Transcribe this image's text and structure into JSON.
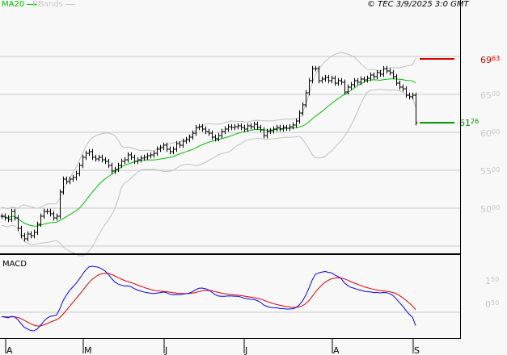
{
  "header": {
    "legend_ma": "MA20",
    "legend_bb": "BBands",
    "copyright": "© TEC 3/9/2025 3:0 GMT"
  },
  "colors": {
    "ma": "#00c000",
    "bb": "#c0c0c0",
    "high": "#d00000",
    "last": "#009000",
    "macd": "#0000ff",
    "signal": "#e00000"
  },
  "chart_data": {
    "type": "ohlc",
    "title": "",
    "ylim": [
      4500,
      7250
    ],
    "yticks": [
      {
        "v": 7000,
        "main": "69",
        "sup": "63"
      },
      {
        "v": 6500,
        "main": "65",
        "sup": "00"
      },
      {
        "v": 6000,
        "main": "60",
        "sup": "00"
      },
      {
        "v": 5500,
        "main": "55",
        "sup": "00"
      },
      {
        "v": 5000,
        "main": "50",
        "sup": "00"
      }
    ],
    "high_marker": {
      "value": 6963,
      "main": "69",
      "sup": "63"
    },
    "last_marker": {
      "value": 6126,
      "main": "61",
      "sup": "26"
    },
    "months": [
      "A",
      "M",
      "J",
      "J",
      "A",
      "S"
    ],
    "closes": [
      4894,
      4872,
      4851,
      4957,
      4872,
      4734,
      4638,
      4596,
      4660,
      4638,
      4681,
      4787,
      4894,
      4957,
      4957,
      4926,
      4872,
      4894,
      5213,
      5383,
      5351,
      5383,
      5404,
      5457,
      5564,
      5670,
      5723,
      5745,
      5670,
      5649,
      5670,
      5638,
      5617,
      5564,
      5489,
      5511,
      5564,
      5617,
      5638,
      5702,
      5670,
      5617,
      5638,
      5660,
      5670,
      5692,
      5702,
      5723,
      5777,
      5798,
      5830,
      5777,
      5745,
      5777,
      5851,
      5830,
      5883,
      5904,
      5936,
      5989,
      6064,
      6074,
      6043,
      6011,
      5989,
      5936,
      5915,
      5957,
      6011,
      6043,
      6074,
      6064,
      6074,
      6085,
      6064,
      6043,
      6085,
      6074,
      6106,
      6064,
      6032,
      5957,
      6011,
      6021,
      6043,
      6064,
      6043,
      6064,
      6053,
      6074,
      6096,
      6149,
      6255,
      6362,
      6521,
      6681,
      6840,
      6840,
      6681,
      6702,
      6723,
      6681,
      6713,
      6649,
      6681,
      6660,
      6532,
      6596,
      6628,
      6681,
      6660,
      6702,
      6691,
      6713,
      6755,
      6734,
      6787,
      6766,
      6840,
      6809,
      6787,
      6734,
      6649,
      6596,
      6574,
      6489,
      6468,
      6489,
      6126
    ],
    "macd": {
      "label": "MACD",
      "ticks": [
        {
          "main": "1",
          "sup": "50"
        },
        {
          "main": "0",
          "sup": "50"
        }
      ]
    }
  }
}
